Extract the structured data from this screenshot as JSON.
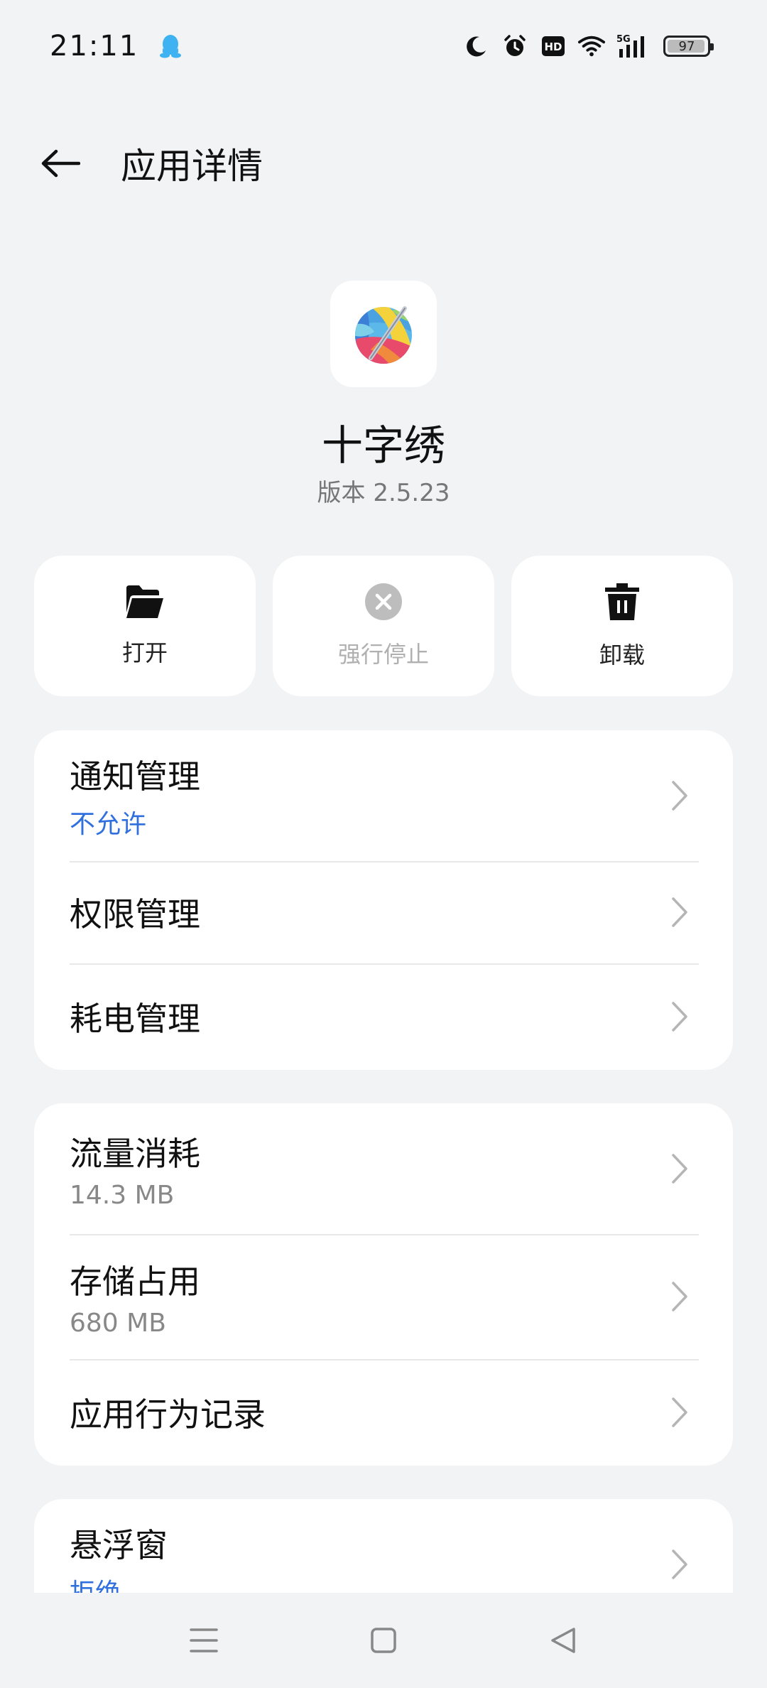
{
  "status_bar": {
    "time": "21:11",
    "battery": "97",
    "battery_level": 0.97,
    "icons": [
      "qq-icon",
      "moon-icon",
      "alarm-icon",
      "hd-icon",
      "wifi-icon",
      "5g-signal-icon",
      "battery-icon"
    ]
  },
  "header": {
    "title": "应用详情"
  },
  "app": {
    "name": "十字绣",
    "version": "版本 2.5.23"
  },
  "actions": [
    {
      "label": "打开",
      "icon": "folder-open-icon",
      "enabled": true
    },
    {
      "label": "强行停止",
      "icon": "close-circle-icon",
      "enabled": false
    },
    {
      "label": "卸载",
      "icon": "trash-icon",
      "enabled": true
    }
  ],
  "group1": [
    {
      "title": "通知管理",
      "sub": "不允许"
    },
    {
      "title": "权限管理"
    },
    {
      "title": "耗电管理"
    }
  ],
  "group2": [
    {
      "title": "流量消耗",
      "sub": "14.3 MB"
    },
    {
      "title": "存储占用",
      "sub": "680 MB"
    },
    {
      "title": "应用行为记录"
    }
  ],
  "group3": [
    {
      "title": "悬浮窗",
      "sub": "拒绝"
    }
  ],
  "colors": {
    "accent_blue": "#2f6fde",
    "background": "#f2f3f5",
    "card": "#ffffff"
  },
  "navbar": {
    "icons": [
      "menu-icon",
      "home-icon",
      "back-triangle-icon"
    ]
  }
}
